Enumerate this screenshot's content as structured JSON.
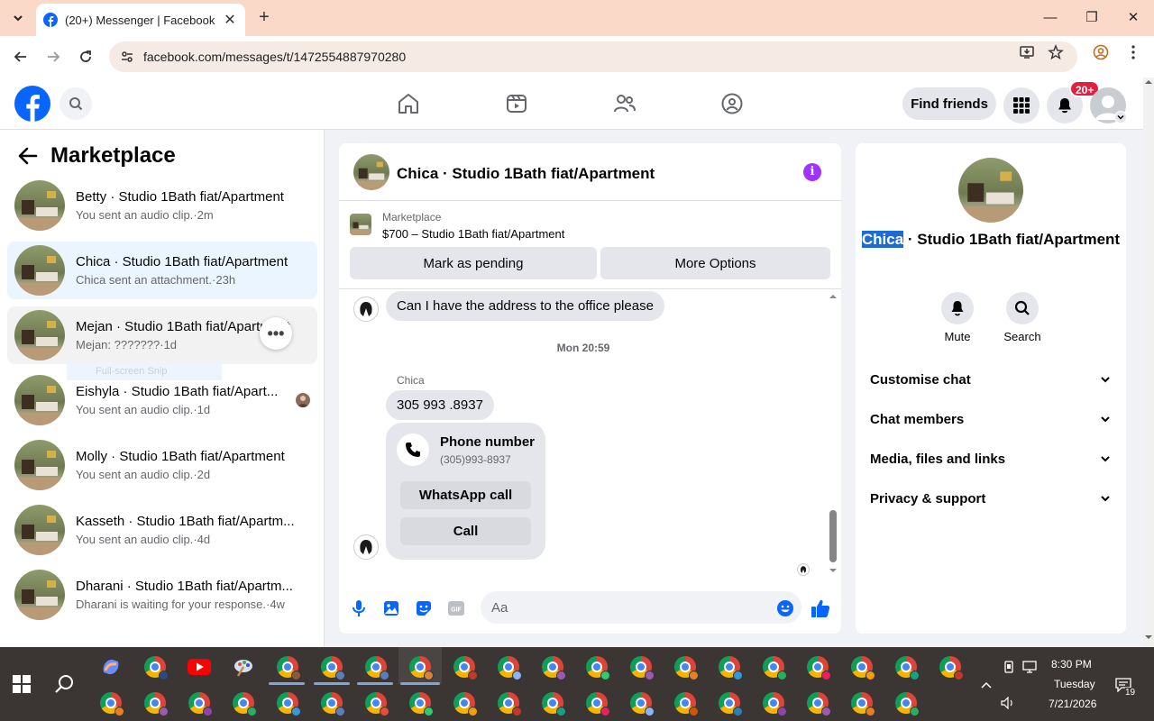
{
  "browser": {
    "tab_title": "(20+) Messenger | Facebook",
    "url": "facebook.com/messages/t/1472554887970280"
  },
  "fb": {
    "find_friends": "Find friends",
    "notif_badge": "20+"
  },
  "left_panel": {
    "title": "Marketplace",
    "conversations": [
      {
        "name": "Betty · Studio 1Bath fiat/Apartment",
        "sub": "You sent an audio clip.·2m"
      },
      {
        "name": "Chica · Studio 1Bath fiat/Apartment",
        "sub": "Chica sent an attachment.·23h"
      },
      {
        "name": "Mejan · Studio 1Bath fiat/Apartment",
        "sub": "Mejan: ???????·1d"
      },
      {
        "name": "Eishyla · Studio 1Bath fiat/Apart...",
        "sub": "You sent an audio clip.·1d"
      },
      {
        "name": "Molly · Studio 1Bath fiat/Apartment",
        "sub": "You sent an audio clip.·2d"
      },
      {
        "name": "Kasseth · Studio 1Bath fiat/Apartm...",
        "sub": "You sent an audio clip.·4d"
      },
      {
        "name": "Dharani · Studio 1Bath fiat/Apartm...",
        "sub": "Dharani is waiting for your response.·4w"
      }
    ],
    "snip_ghost": "Full-screen Snip"
  },
  "chat": {
    "title": "Chica · Studio 1Bath fiat/Apartment",
    "marketplace_label": "Marketplace",
    "listing": "$700 – Studio 1Bath fiat/Apartment",
    "mark_pending": "Mark as pending",
    "more_options": "More Options",
    "messages": {
      "m1": "Can I have the address to the office please",
      "timestamp": "Mon 20:59",
      "sender": "Chica",
      "m2": "305 993 .8937"
    },
    "phone_card": {
      "title": "Phone number",
      "number": "(305)993-8937",
      "whatsapp": "WhatsApp call",
      "call": "Call"
    },
    "composer_placeholder": "Aa"
  },
  "right_panel": {
    "name_highlight": "Chica",
    "name_rest": " · Studio 1Bath fiat/Apartment",
    "mute": "Mute",
    "search": "Search",
    "sections": [
      "Customise chat",
      "Chat members",
      "Media, files and links",
      "Privacy & support"
    ]
  },
  "taskbar": {
    "time": "8:30 PM",
    "day": "Tuesday",
    "date": "7/21/2026",
    "notifications": "19"
  },
  "colors": {
    "fb_blue": "#0866ff",
    "active_conv": "#ebf5ff",
    "messenger_purple": "#a033ff",
    "badge_red": "#e41e3f"
  }
}
